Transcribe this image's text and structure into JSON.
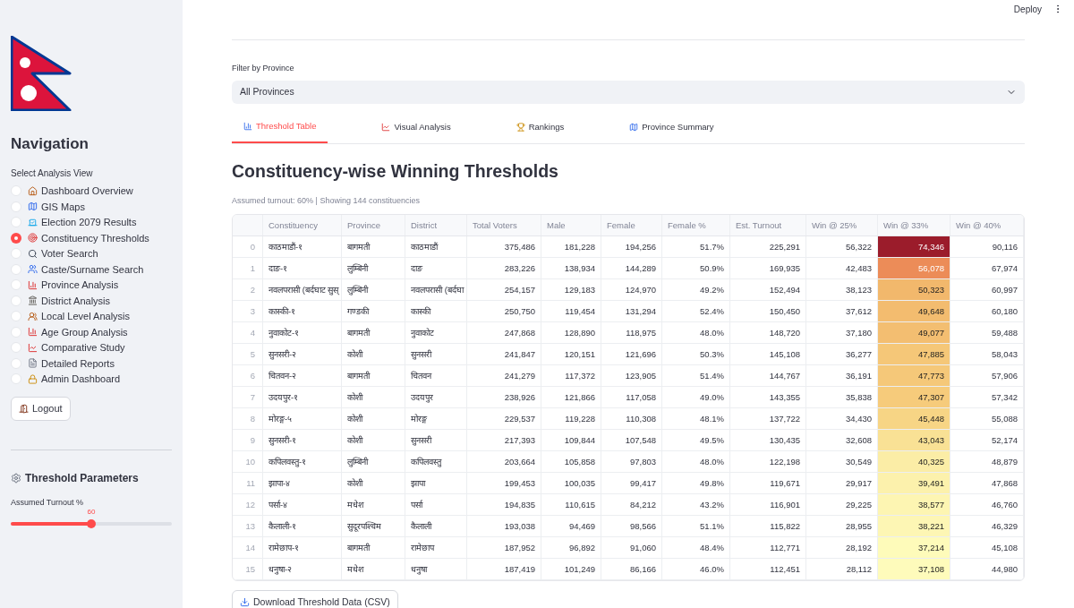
{
  "header": {
    "deploy": "Deploy"
  },
  "sidebar": {
    "title": "Navigation",
    "radio_label": "Select Analysis View",
    "items": [
      {
        "label": "Dashboard Overview",
        "selected": false
      },
      {
        "label": "GIS Maps",
        "selected": false
      },
      {
        "label": "Election 2079 Results",
        "selected": false
      },
      {
        "label": "Constituency Thresholds",
        "selected": true
      },
      {
        "label": "Voter Search",
        "selected": false
      },
      {
        "label": "Caste/Surname Search",
        "selected": false
      },
      {
        "label": "Province Analysis",
        "selected": false
      },
      {
        "label": "District Analysis",
        "selected": false
      },
      {
        "label": "Local Level Analysis",
        "selected": false
      },
      {
        "label": "Age Group Analysis",
        "selected": false
      },
      {
        "label": "Comparative Study",
        "selected": false
      },
      {
        "label": "Detailed Reports",
        "selected": false
      },
      {
        "label": "Admin Dashboard",
        "selected": false
      }
    ],
    "logout": "Logout",
    "parameters_title": "Threshold Parameters",
    "slider": {
      "label": "Assumed Turnout %",
      "value": "60",
      "level": 0.5
    }
  },
  "filter": {
    "label": "Filter by Province",
    "value": "All Provinces"
  },
  "tabs": [
    {
      "label": "Threshold Table",
      "selected": true
    },
    {
      "label": "Visual Analysis",
      "selected": false
    },
    {
      "label": "Rankings",
      "selected": false
    },
    {
      "label": "Province Summary",
      "selected": false
    }
  ],
  "heading": "Constituency-wise Winning Thresholds",
  "caption": "Assumed turnout: 60% | Showing 144 constituencies",
  "table": {
    "columns": [
      "Constituency",
      "Province",
      "District",
      "Total Voters",
      "Male",
      "Female",
      "Female %",
      "Est. Turnout",
      "Win @ 25%",
      "Win @ 33%",
      "Win @ 40%"
    ],
    "rows": [
      {
        "index": "0",
        "cells": [
          "काठमाडौं-१",
          "बागमती",
          "काठमाडौं",
          "375,486",
          "181,228",
          "194,256",
          "51.7%",
          "225,291",
          "56,322",
          "74,346",
          "90,116"
        ],
        "color": "#9b1c2b"
      },
      {
        "index": "1",
        "cells": [
          "दाङ-१",
          "लुम्बिनी",
          "दाङ",
          "283,226",
          "138,934",
          "144,289",
          "50.9%",
          "169,935",
          "42,483",
          "56,078",
          "67,974"
        ],
        "color": "#ec8c58"
      },
      {
        "index": "2",
        "cells": [
          "नवलपरासी (बर्दघाट सुस्",
          "लुम्बिनी",
          "नवलपरासी (बर्दघा",
          "254,157",
          "129,183",
          "124,970",
          "49.2%",
          "152,494",
          "38,123",
          "50,323",
          "60,997"
        ],
        "color": "#f2b86c"
      },
      {
        "index": "3",
        "cells": [
          "कास्की-१",
          "गण्डकी",
          "कास्की",
          "250,750",
          "119,454",
          "131,294",
          "52.4%",
          "150,450",
          "37,612",
          "49,648",
          "60,180"
        ],
        "color": "#f3bc6f"
      },
      {
        "index": "4",
        "cells": [
          "नुवाकोट-१",
          "बागमती",
          "नुवाकोट",
          "247,868",
          "128,890",
          "118,975",
          "48.0%",
          "148,720",
          "37,180",
          "49,077",
          "59,488"
        ],
        "color": "#f3be71"
      },
      {
        "index": "5",
        "cells": [
          "सुनसरी-२",
          "कोशी",
          "सुनसरी",
          "241,847",
          "120,151",
          "121,696",
          "50.3%",
          "145,108",
          "36,277",
          "47,885",
          "58,043"
        ],
        "color": "#f5c778"
      },
      {
        "index": "6",
        "cells": [
          "चितवन-२",
          "बागमती",
          "चितवन",
          "241,279",
          "117,372",
          "123,905",
          "51.4%",
          "144,767",
          "36,191",
          "47,773",
          "57,906"
        ],
        "color": "#f5c879"
      },
      {
        "index": "7",
        "cells": [
          "उदयपुर-१",
          "कोशी",
          "उदयपुर",
          "238,926",
          "121,866",
          "117,058",
          "49.0%",
          "143,355",
          "35,838",
          "47,307",
          "57,342"
        ],
        "color": "#f6cb7b"
      },
      {
        "index": "8",
        "cells": [
          "मोरङ्ग-५",
          "कोशी",
          "मोरङ्ग",
          "229,537",
          "119,228",
          "110,308",
          "48.1%",
          "137,722",
          "34,430",
          "45,448",
          "55,088"
        ],
        "color": "#f7d585"
      },
      {
        "index": "9",
        "cells": [
          "सुनसरी-१",
          "कोशी",
          "सुनसरी",
          "217,393",
          "109,844",
          "107,548",
          "49.5%",
          "130,435",
          "32,608",
          "43,043",
          "52,174"
        ],
        "color": "#f9e195"
      },
      {
        "index": "10",
        "cells": [
          "कपिलवस्तु-१",
          "लुम्बिनी",
          "कपिलवस्तु",
          "203,664",
          "105,858",
          "97,803",
          "48.0%",
          "122,198",
          "30,549",
          "40,325",
          "48,879"
        ],
        "color": "#fbeda6"
      },
      {
        "index": "11",
        "cells": [
          "झापा-४",
          "कोशी",
          "झापा",
          "199,453",
          "100,035",
          "99,417",
          "49.8%",
          "119,671",
          "29,917",
          "39,491",
          "47,868"
        ],
        "color": "#fcf1ac"
      },
      {
        "index": "12",
        "cells": [
          "पर्सा-४",
          "मधेश",
          "पर्सा",
          "194,835",
          "110,615",
          "84,212",
          "43.2%",
          "116,901",
          "29,225",
          "38,577",
          "46,760"
        ],
        "color": "#fdf5b2"
      },
      {
        "index": "13",
        "cells": [
          "कैलाली-१",
          "सुदूरपश्चिम",
          "कैलाली",
          "193,038",
          "94,469",
          "98,566",
          "51.1%",
          "115,822",
          "28,955",
          "38,221",
          "46,329"
        ],
        "color": "#fdf6b4"
      },
      {
        "index": "14",
        "cells": [
          "रामेछाप-१",
          "बागमती",
          "रामेछाप",
          "187,952",
          "96,892",
          "91,060",
          "48.4%",
          "112,771",
          "28,192",
          "37,214",
          "45,108"
        ],
        "color": "#fefbba"
      },
      {
        "index": "15",
        "cells": [
          "धनुषा-२",
          "मधेश",
          "धनुषा",
          "187,419",
          "101,249",
          "86,166",
          "46.0%",
          "112,451",
          "28,112",
          "37,108",
          "44,980"
        ],
        "color": "#fefbbb"
      }
    ]
  },
  "download_button": "Download Threshold Data (CSV)"
}
